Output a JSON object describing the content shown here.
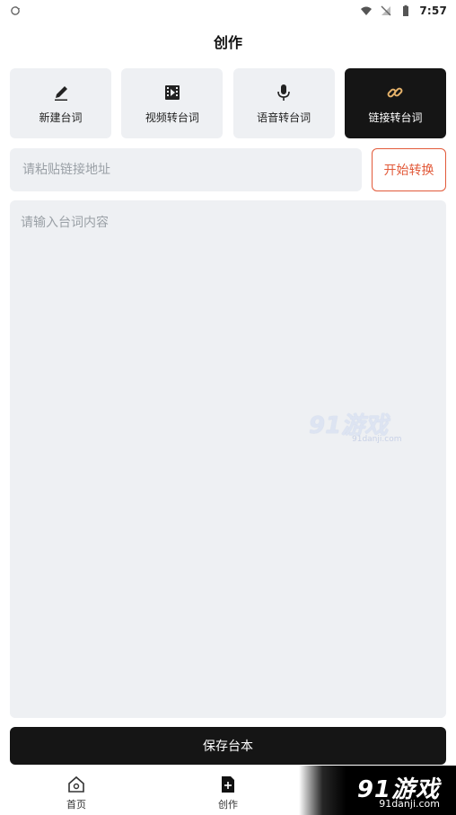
{
  "status": {
    "time": "7:57"
  },
  "header": {
    "title": "创作"
  },
  "modes": [
    {
      "label": "新建台词",
      "icon": "pencil-icon",
      "active": false
    },
    {
      "label": "视频转台词",
      "icon": "film-icon",
      "active": false
    },
    {
      "label": "语音转台词",
      "icon": "microphone-icon",
      "active": false
    },
    {
      "label": "链接转台词",
      "icon": "link-icon",
      "active": true
    }
  ],
  "link": {
    "placeholder": "请粘贴链接地址",
    "start_label": "开始转换"
  },
  "script": {
    "placeholder": "请输入台词内容"
  },
  "actions": {
    "save_label": "保存台本"
  },
  "nav": [
    {
      "label": "首页",
      "icon": "home-icon"
    },
    {
      "label": "创作",
      "icon": "create-icon"
    }
  ],
  "watermark": {
    "center_text": "91游戏",
    "center_site": "91danji.com",
    "corner_text": "91游戏",
    "corner_site": "91danji.com"
  },
  "colors": {
    "accent": "#e25a3a",
    "dark": "#151515",
    "card_bg": "#eef0f3",
    "link_icon": "#e6b36b"
  }
}
